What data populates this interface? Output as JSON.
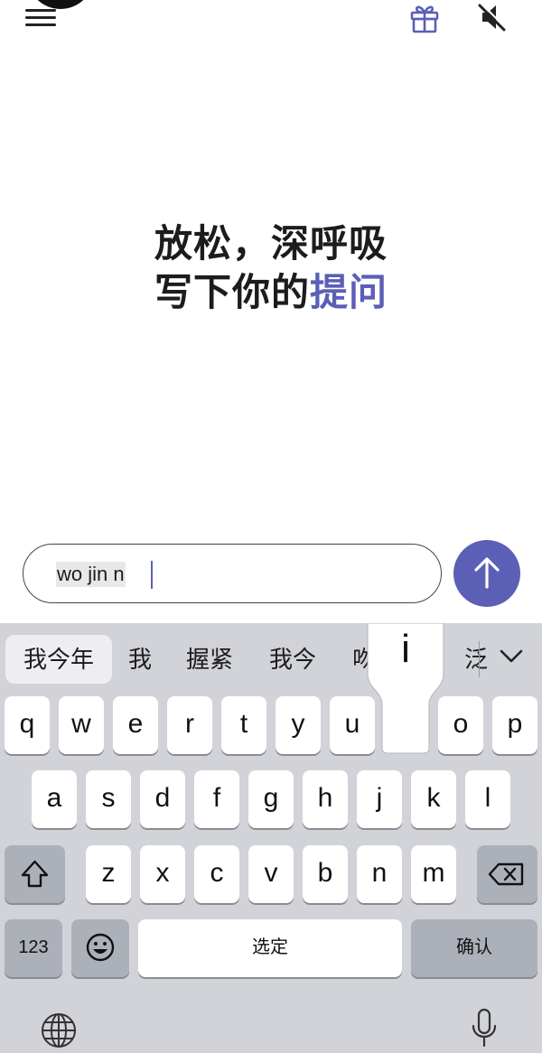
{
  "header": {
    "menu_icon": "hamburger-menu-icon",
    "gift_icon": "gift-icon",
    "mute_icon": "speaker-muted-icon",
    "accent_color": "#5b5fb6"
  },
  "headline": {
    "line1": "放松，深呼吸",
    "line2_plain": "写下你的",
    "line2_accent": "提问"
  },
  "composer": {
    "input_value": "wo jin n",
    "send_icon": "arrow-up-icon"
  },
  "keyboard": {
    "candidates": [
      "我今年",
      "我",
      "握紧",
      "我今",
      "吻",
      "泛"
    ],
    "popup_letter": "i",
    "row1": [
      "q",
      "w",
      "e",
      "r",
      "t",
      "y",
      "u",
      "i",
      "o",
      "p"
    ],
    "row2": [
      "a",
      "s",
      "d",
      "f",
      "g",
      "h",
      "j",
      "k",
      "l"
    ],
    "row3": [
      "z",
      "x",
      "c",
      "v",
      "b",
      "n",
      "m"
    ],
    "numbers_label": "123",
    "space_label": "选定",
    "return_label": "确认",
    "shift_icon": "shift-icon",
    "delete_icon": "backspace-icon",
    "emoji_icon": "emoji-icon",
    "globe_icon": "globe-icon",
    "mic_icon": "microphone-icon"
  }
}
